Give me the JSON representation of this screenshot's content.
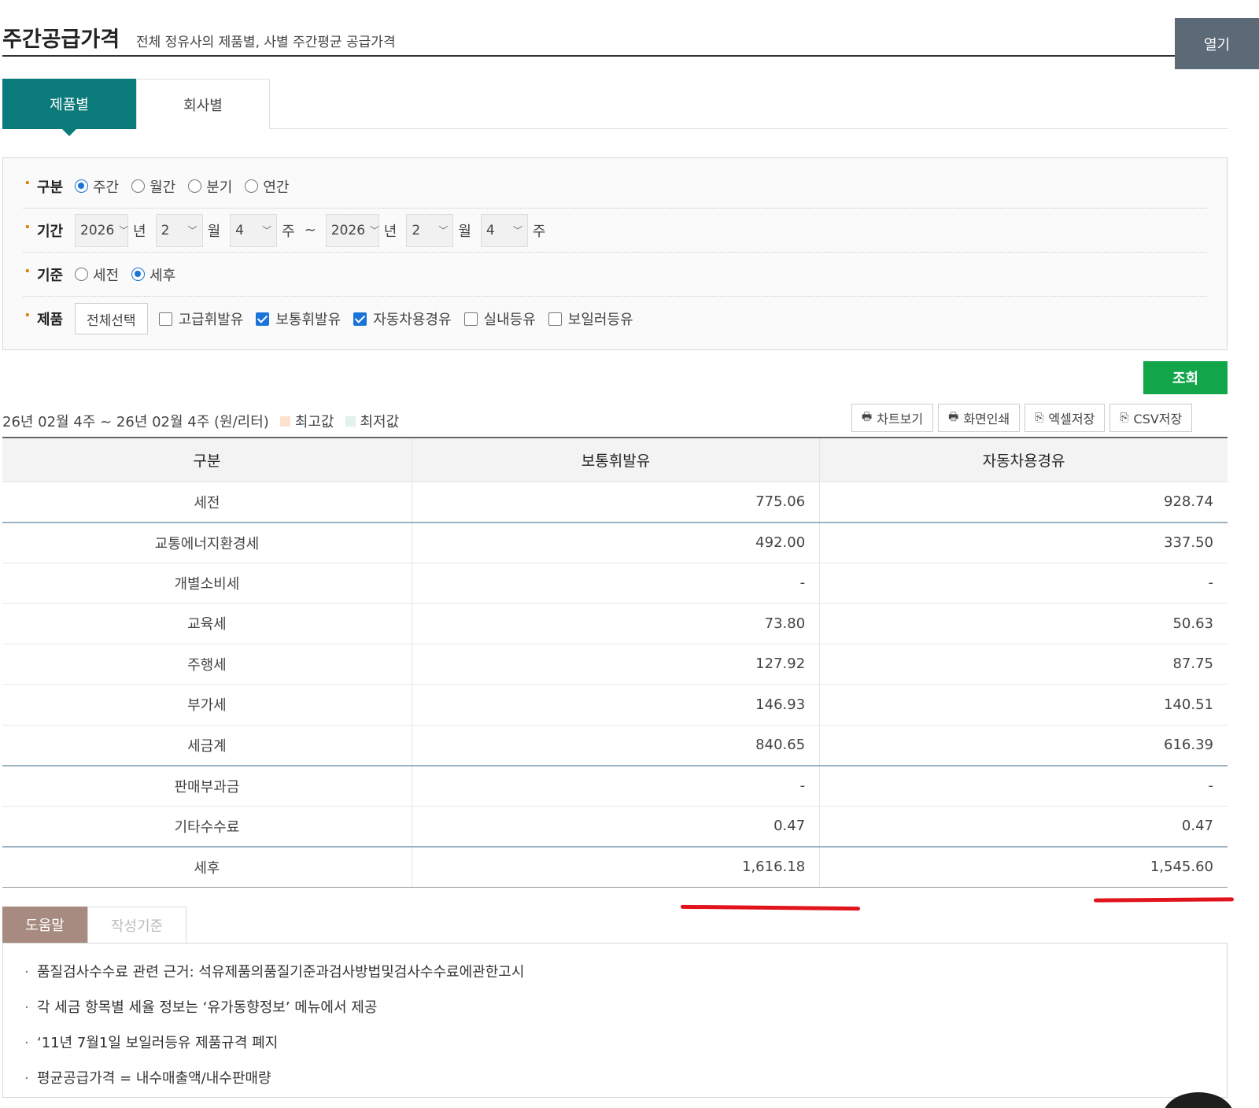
{
  "header": {
    "title": "주간공급가격",
    "subtitle": "전체 정유사의 제품별, 사별 주간평균 공급가격",
    "open_button": "열기"
  },
  "tabs": [
    {
      "label": "제품별",
      "active": true
    },
    {
      "label": "회사별",
      "active": false
    }
  ],
  "filter": {
    "division": {
      "label": "구분",
      "options": [
        {
          "label": "주간",
          "checked": true
        },
        {
          "label": "월간",
          "checked": false
        },
        {
          "label": "분기",
          "checked": false
        },
        {
          "label": "연간",
          "checked": false
        }
      ]
    },
    "period": {
      "label": "기간",
      "from": {
        "year": "2026",
        "month": "2",
        "week": "4"
      },
      "to": {
        "year": "2026",
        "month": "2",
        "week": "4"
      },
      "unit_year": "년",
      "unit_month": "월",
      "unit_week": "주",
      "tilde": "~"
    },
    "basis": {
      "label": "기준",
      "options": [
        {
          "label": "세전",
          "checked": false
        },
        {
          "label": "세후",
          "checked": true
        }
      ]
    },
    "product": {
      "label": "제품",
      "select_all": "전체선택",
      "options": [
        {
          "label": "고급휘발유",
          "checked": false
        },
        {
          "label": "보통휘발유",
          "checked": true
        },
        {
          "label": "자동차용경유",
          "checked": true
        },
        {
          "label": "실내등유",
          "checked": false
        },
        {
          "label": "보일러등유",
          "checked": false
        }
      ]
    }
  },
  "search_button": "조회",
  "info": {
    "range": "26년 02월 4주 ~ 26년 02월 4주 (원/리터)",
    "legend_max": "최고값",
    "legend_min": "최저값",
    "legend_max_color": "#fde3cf",
    "legend_min_color": "#e3f1ee"
  },
  "tools": [
    "차트보기",
    "화면인쇄",
    "엑셀저장",
    "CSV저장"
  ],
  "table": {
    "headers": [
      "구분",
      "보통휘발유",
      "자동차용경유"
    ],
    "rows": [
      {
        "label": "세전",
        "v1": "775.06",
        "v2": "928.74"
      },
      {
        "label": "교통에너지환경세",
        "v1": "492.00",
        "v2": "337.50"
      },
      {
        "label": "개별소비세",
        "v1": "-",
        "v2": "-"
      },
      {
        "label": "교육세",
        "v1": "73.80",
        "v2": "50.63"
      },
      {
        "label": "주행세",
        "v1": "127.92",
        "v2": "87.75"
      },
      {
        "label": "부가세",
        "v1": "146.93",
        "v2": "140.51"
      },
      {
        "label": "세금계",
        "v1": "840.65",
        "v2": "616.39"
      },
      {
        "label": "판매부과금",
        "v1": "-",
        "v2": "-"
      },
      {
        "label": "기타수수료",
        "v1": "0.47",
        "v2": "0.47"
      },
      {
        "label": "세후",
        "v1": "1,616.18",
        "v2": "1,545.60"
      }
    ]
  },
  "help": {
    "tabs": [
      "도움말",
      "작성기준"
    ],
    "items": [
      "품질검사수수료 관련 근거: 석유제품의품질기준과검사방법및검사수수료에관한고시",
      "각 세금 항목별 세율 정보는 ‘유가동향정보’ 메뉴에서 제공",
      "‘11년 7월1일 보일러등유 제품규격 폐지",
      "평균공급가격 = 내수매출액/내수판매량"
    ]
  },
  "accent_colors": {
    "tab_active": "#0b7a7a",
    "search_button": "#13a54a",
    "open_button": "#5c6a78",
    "help_tab_active": "#a88b80",
    "annotation": "#e1141e"
  }
}
